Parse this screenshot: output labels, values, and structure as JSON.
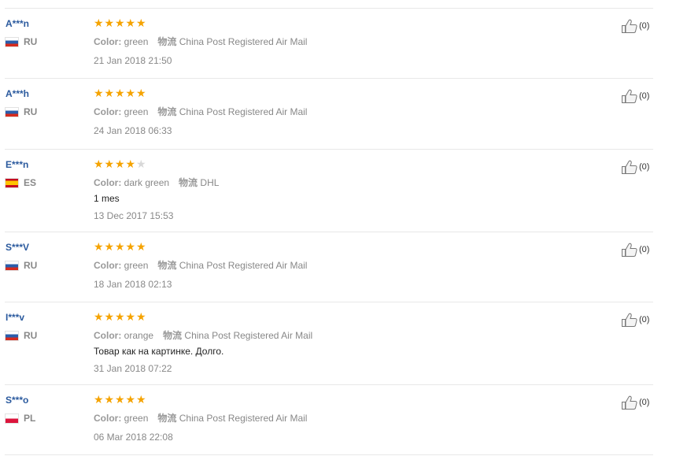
{
  "labels": {
    "color": "Color:",
    "shipping": "物流"
  },
  "colors": {
    "username": "#2b5a9e",
    "star_on": "#f5a300",
    "star_off": "#d8d8d8",
    "meta_text": "#888888",
    "comment_text": "#222222"
  },
  "reviews": [
    {
      "user": "A***n",
      "country": "RU",
      "rating": 5,
      "color": "green",
      "shipping": "China Post Registered Air Mail",
      "comment": "",
      "date": "21 Jan 2018 21:50",
      "helpful": "(0)"
    },
    {
      "user": "A***h",
      "country": "RU",
      "rating": 5,
      "color": "green",
      "shipping": "China Post Registered Air Mail",
      "comment": "",
      "date": "24 Jan 2018 06:33",
      "helpful": "(0)"
    },
    {
      "user": "E***n",
      "country": "ES",
      "rating": 4,
      "color": "dark green",
      "shipping": "DHL",
      "comment": "1 mes",
      "date": "13 Dec 2017 15:53",
      "helpful": "(0)"
    },
    {
      "user": "S***V",
      "country": "RU",
      "rating": 5,
      "color": "green",
      "shipping": "China Post Registered Air Mail",
      "comment": "",
      "date": "18 Jan 2018 02:13",
      "helpful": "(0)"
    },
    {
      "user": "I***v",
      "country": "RU",
      "rating": 5,
      "color": "orange",
      "shipping": "China Post Registered Air Mail",
      "comment": "Товар как на картинке. Долго.",
      "date": "31 Jan 2018 07:22",
      "helpful": "(0)"
    },
    {
      "user": "S***o",
      "country": "PL",
      "rating": 5,
      "color": "green",
      "shipping": "China Post Registered Air Mail",
      "comment": "",
      "date": "06 Mar 2018 22:08",
      "helpful": "(0)"
    }
  ]
}
